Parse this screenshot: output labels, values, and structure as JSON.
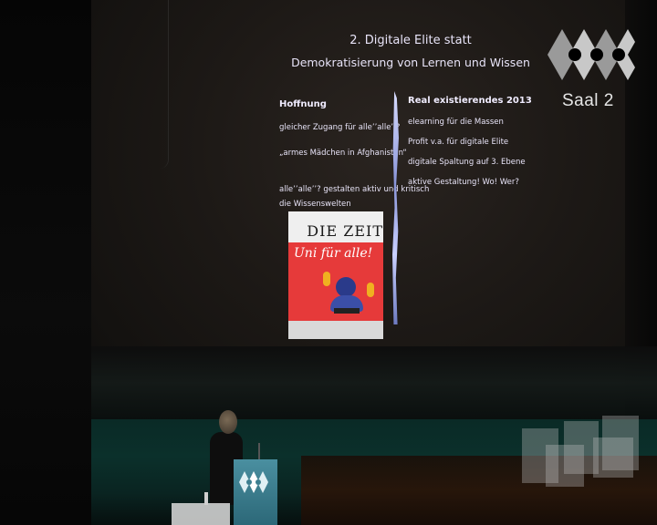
{
  "slide": {
    "title_line1": "2.  Digitale Elite statt",
    "title_line2": "Demokratisierung von Lernen und Wissen",
    "left": {
      "heading": "Hoffnung",
      "lines": [
        "gleicher Zugang für alle’’alle’’?",
        "„armes Mädchen in Afghanistan“",
        "alle’’alle’’? gestalten aktiv und kritisch",
        "die Wissenswelten"
      ]
    },
    "right": {
      "heading": "Real existierendes 2013",
      "lines": [
        "elearning für die Massen",
        "Profit v.a. für digitale Elite",
        "digitale Spaltung auf 3. Ebene",
        "aktive Gestaltung! Wo! Wer?"
      ]
    },
    "image": {
      "masthead": "DIE ZEIT",
      "banner": "Uni für alle!"
    }
  },
  "overlay": {
    "channel_label": "Saal 2"
  },
  "colors": {
    "slide_text": "#e8e4f8",
    "divider": "#aab4f0",
    "stage_floor": "#0b302b",
    "podium": "#3d7f90"
  },
  "icons": [
    "venue-logo-icon",
    "podium-logo-icon"
  ]
}
